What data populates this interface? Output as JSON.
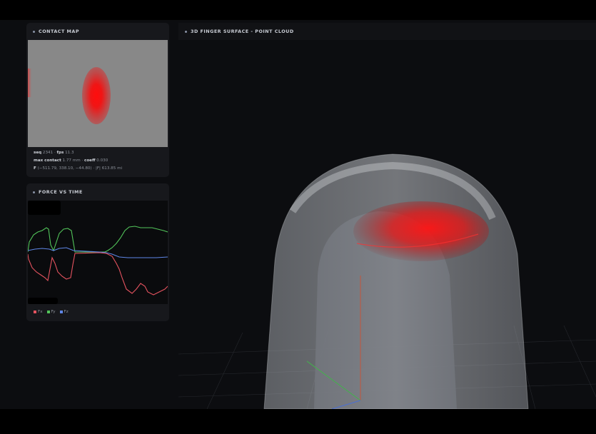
{
  "contact_map": {
    "title": "CONTACT MAP",
    "seq_label": "seq",
    "seq_value": "2341",
    "fps_label": "fps",
    "fps_value": "11.3",
    "max_contact_label": "max contact",
    "max_contact_value": "1.77 mm",
    "coeff_label": "coeff",
    "coeff_value": "0.030",
    "force_label": "F",
    "force_value": "(−511.79, 338.10, −44.80) · |F| 613.85 mi"
  },
  "force_vs_time": {
    "title": "FORCE VS TIME",
    "legend": [
      {
        "label": "Fx",
        "color": "#e5535f"
      },
      {
        "label": "Fy",
        "color": "#52c45a"
      },
      {
        "label": "Fz",
        "color": "#5f86e6"
      }
    ]
  },
  "view3d": {
    "title": "3D FINGER SURFACE - POINT CLOUD"
  },
  "colors": {
    "background": "#0c0d10",
    "panel": "#17181c",
    "contact": "#ff1a1a",
    "fx": "#e5535f",
    "fy": "#52c45a",
    "fz": "#5f86e6"
  }
}
